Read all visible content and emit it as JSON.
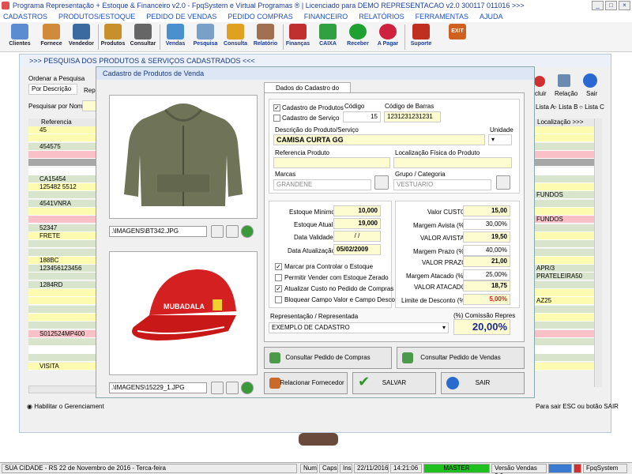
{
  "window": {
    "title": "Programa Representação + Estoque & Financeiro v2.0 - FpqSystem e Virtual Programas ® | Licenciado para DEMO REPRESENTACAO v2.0 300117 011016 >>>"
  },
  "menu": [
    "CADASTROS",
    "PRODUTOS/ESTOQUE",
    "PEDIDO DE VENDAS",
    "PEDIDO COMPRAS",
    "FINANCEIRO",
    "RELATÓRIOS",
    "FERRAMENTAS",
    "AJUDA"
  ],
  "toolbar": [
    {
      "label": "Clientes",
      "color": "#5b8bd0",
      "icon": "clients-icon"
    },
    {
      "label": "Fornece",
      "color": "#d08a3a",
      "icon": "supplier-icon"
    },
    {
      "label": "Vendedor",
      "color": "#3a6aa0",
      "icon": "seller-icon"
    },
    {
      "label": "Produtos",
      "color": "#c8902c",
      "icon": "products-icon"
    },
    {
      "label": "Consultar",
      "color": "#666666",
      "icon": "consult-icon"
    },
    {
      "label": "Vendas",
      "color": "#4a8fd0",
      "icon": "sales-icon"
    },
    {
      "label": "Pesquisa",
      "color": "#7aa0c8",
      "icon": "search-icon"
    },
    {
      "label": "Consulta",
      "color": "#e0a020",
      "icon": "folder-icon"
    },
    {
      "label": "Relatório",
      "color": "#a07050",
      "icon": "report-icon"
    },
    {
      "label": "Finanças",
      "color": "#c03030",
      "icon": "finance-icon"
    },
    {
      "label": "CAIXA",
      "color": "#30a040",
      "icon": "cash-icon"
    },
    {
      "label": "Receber",
      "color": "#20a030",
      "icon": "receive-icon"
    },
    {
      "label": "A Pagar",
      "color": "#d02040",
      "icon": "pay-icon"
    },
    {
      "label": "Suporte",
      "color": "#c03020",
      "icon": "support-icon"
    },
    {
      "label": "EXIT",
      "color": "#d06020",
      "icon": "exit-icon"
    }
  ],
  "search_panel": {
    "title": ">>> PESQUISA DOS PRODUTOS & SERVIÇOS CADASTRADOS <<<",
    "order_label": "Ordenar a Pesquisa",
    "order_value": "Por Descrição",
    "search_by_label": "Pesquisar por Nome",
    "repr_label": "Repre",
    "col_ref": "Referencia",
    "col_loc": "Localização >>>",
    "rows": [
      "45",
      "",
      "454575",
      "",
      "",
      "",
      "CA15454",
      "125482 5512",
      "",
      "4541VNRA",
      "",
      "",
      "52347",
      "FRETE",
      "",
      "",
      "188BC",
      "123456123456",
      "",
      "1284RD",
      "",
      "",
      "",
      "",
      "",
      "S012524MP400",
      "",
      "",
      "",
      "VISITA"
    ],
    "right_rows": [
      "",
      "",
      "",
      "",
      "",
      "",
      "",
      "",
      "FUNDOS",
      "",
      "",
      "FUNDOS",
      "",
      "",
      "",
      "",
      "",
      "APR/3",
      "PRATELEIRA50",
      "",
      "",
      "AZ25",
      "",
      "",
      "",
      "",
      "",
      "",
      "",
      "",
      ""
    ],
    "excluir": "cluir",
    "relacao": "Relação",
    "sair": "Sair",
    "lista_a": "Lista A",
    "lista_b": "Lista B",
    "lista_c": "Lista C",
    "hint": "Habilitar o Gerenciament",
    "hint_right": "Para sair ESC ou botão SAIR"
  },
  "modal": {
    "title": "Cadastro de Produtos de Venda",
    "tab": "Dados do Cadastro do Produto",
    "img1_path": ".\\IMAGENS\\BT342.JPG",
    "img2_path": ".\\IMAGENS\\15229_1.JPG",
    "chk_produtos": "Cadastro de Produtos",
    "chk_servico": "Cadastro de Serviço",
    "codigo_label": "Código",
    "codigo": "15",
    "barras_label": "Código de Barras",
    "barras": "1231231231231",
    "descricao_label": "Descrição do Produto/Serviço",
    "descricao": "CAMISA CURTA GG",
    "unidade_label": "Unidade",
    "ref_label": "Referencia Produto",
    "loc_label": "Localização Física do Produto",
    "marcas_label": "Marcas",
    "marcas": "GRANDENE",
    "grupo_label": "Grupo / Categoria",
    "grupo": "VESTUARIO",
    "estoque_min_label": "Estoque Mínimo",
    "estoque_min": "10,000",
    "estoque_atual_label": "Estoque Atual",
    "estoque_atual": "19,000",
    "validade_label": "Data Validade",
    "validade": "/ /",
    "atualizacao_label": "Data Atualização",
    "atualizacao": "05/02/2009",
    "opt1": "Marcar pra Controlar o Estoque",
    "opt2": "Permitir Vender com Estoque Zerado",
    "opt3": "Atualizar Custo no Pedido de Compras",
    "opt4": "Bloquear Campo Valor e Campo Desconto",
    "custo_label": "Valor CUSTO",
    "custo": "15,00",
    "margem_avista_label": "Margem Avista (%)",
    "margem_avista": "30,00%",
    "avista_label": "VALOR AVISTA",
    "avista": "19,50",
    "margem_prazo_label": "Margem Prazo (%)",
    "margem_prazo": "40,00%",
    "prazo_label": "VALOR PRAZO",
    "prazo": "21,00",
    "margem_atacado_label": "Margem Atacado (%)",
    "margem_atacado": "25,00%",
    "atacado_label": "VALOR ATACADO",
    "atacado": "18,75",
    "desconto_label": "Limite de Desconto (%)",
    "desconto": "5,00%",
    "repr_label": "Representação / Representada",
    "repr": "EXEMPLO DE CADASTRO",
    "comissao_label": "(%) Comissão Repres",
    "comissao": "20,00%",
    "btn_compras": "Consultar Pedido de Compras",
    "btn_vendas": "Consultar Pedido de Vendas",
    "btn_fornecedor": "Relacionar Fornecedor",
    "btn_salvar": "SALVAR",
    "btn_sair": "SAIR"
  },
  "status": {
    "city": "SUA CIDADE - RS 22 de Novembro de 2016 - Terca-feira",
    "num": "Num",
    "caps": "Caps",
    "ins": "Ins",
    "date": "22/11/2016",
    "time": "14:21:06",
    "master": "MASTER",
    "version": "Versão Vendas 2.0",
    "brand": "FpqSystem"
  }
}
